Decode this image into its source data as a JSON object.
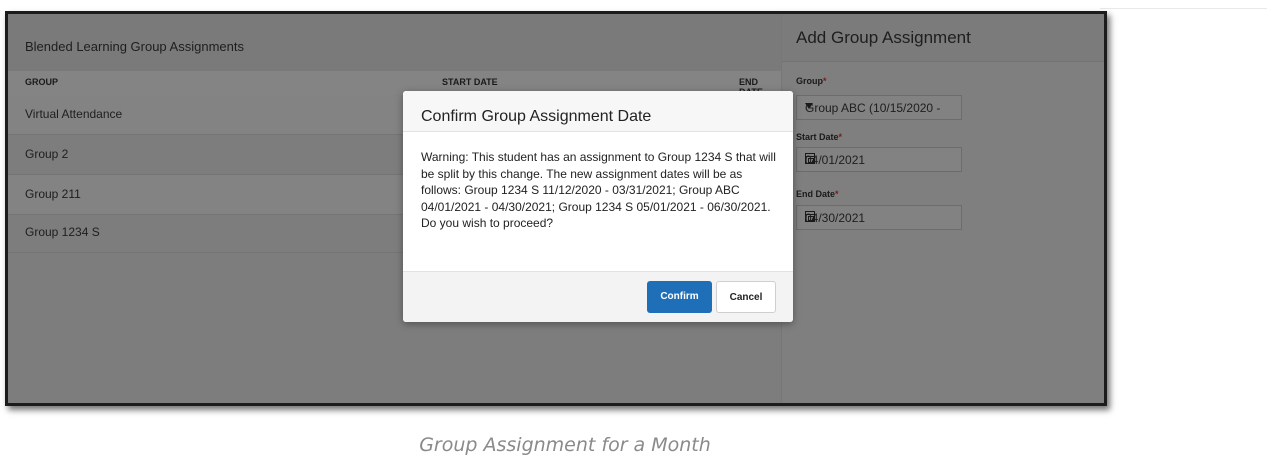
{
  "table": {
    "title": "Blended Learning Group Assignments",
    "columns": [
      "GROUP",
      "START DATE",
      "END DATE"
    ],
    "rows": [
      "Virtual Attendance",
      "Group 2",
      "Group 211",
      "Group 1234 S"
    ]
  },
  "form": {
    "title": "Add Group Assignment",
    "group_label": "Group",
    "group_value": "Group ABC (10/15/2020 -",
    "start_label": "Start Date",
    "start_value": "04/01/2021",
    "end_label": "End Date",
    "end_value": "04/30/2021",
    "required_mark": "*"
  },
  "modal": {
    "title": "Confirm Group Assignment Date",
    "message": "Warning: This student has an assignment to Group 1234 S that will be split by this change. The new assignment dates will be as follows: Group 1234 S 11/12/2020 - 03/31/2021; Group ABC 04/01/2021 - 04/30/2021; Group 1234 S 05/01/2021 - 06/30/2021. Do you wish to proceed?",
    "confirm_label": "Confirm",
    "cancel_label": "Cancel"
  },
  "caption": "Group Assignment for a Month",
  "colors": {
    "confirm_button": "#1f6fb8",
    "required": "#c62828"
  }
}
